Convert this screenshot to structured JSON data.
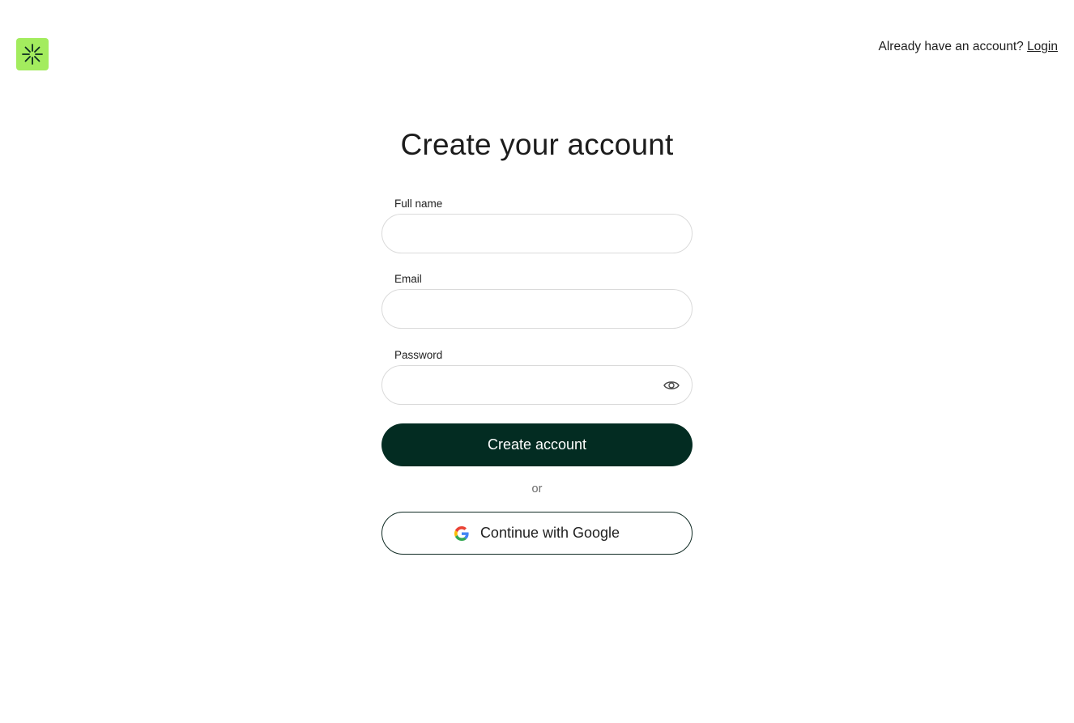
{
  "brand": {
    "logo_icon": "asterisk-burst-icon",
    "logo_bg_color": "#a3ec5e",
    "logo_fg_color": "#0b2a21"
  },
  "header": {
    "prompt": "Already have an account?",
    "login_label": "Login"
  },
  "form": {
    "title": "Create your account",
    "full_name": {
      "label": "Full name",
      "value": "",
      "placeholder": ""
    },
    "email": {
      "label": "Email",
      "value": "",
      "placeholder": ""
    },
    "password": {
      "label": "Password",
      "value": "",
      "placeholder": "",
      "toggle_icon": "eye-icon"
    },
    "submit_label": "Create account",
    "divider_text": "or",
    "google_label": "Continue with Google",
    "google_icon": "google-g-icon"
  },
  "colors": {
    "primary": "#032c22",
    "primary_text": "#ffffff",
    "border": "#dadada"
  }
}
